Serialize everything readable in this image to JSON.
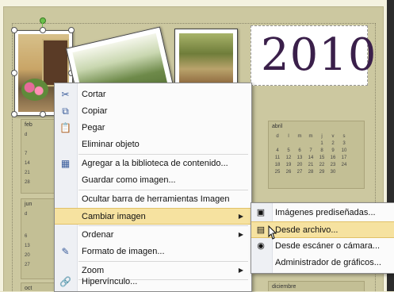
{
  "calendar": {
    "year": "2010",
    "months": {
      "feb": "feb",
      "abril": "abril",
      "jun": "jun",
      "oct": "oct",
      "diciembre": "diciembre"
    },
    "abril_weekdays": [
      "d",
      "l",
      "m",
      "m",
      "j",
      "v",
      "s"
    ],
    "abril_rows": [
      [
        "",
        "",
        "",
        "",
        "1",
        "2",
        "3"
      ],
      [
        "4",
        "5",
        "6",
        "7",
        "8",
        "9",
        "10"
      ],
      [
        "11",
        "12",
        "13",
        "14",
        "15",
        "16",
        "17"
      ],
      [
        "18",
        "19",
        "20",
        "21",
        "22",
        "23",
        "24"
      ],
      [
        "25",
        "26",
        "27",
        "28",
        "29",
        "30",
        ""
      ]
    ],
    "left_partial_days": {
      "feb": [
        "d",
        "7",
        "14",
        "21",
        "28"
      ],
      "jun": [
        "d",
        "6",
        "13",
        "20",
        "27"
      ]
    }
  },
  "context_menu": {
    "items": [
      {
        "label": "Cortar",
        "icon": "scissors-icon"
      },
      {
        "label": "Copiar",
        "icon": "copy-icon"
      },
      {
        "label": "Pegar",
        "icon": "paste-icon"
      },
      {
        "label": "Eliminar objeto",
        "icon": ""
      },
      {
        "label": "Agregar a la biblioteca de contenido...",
        "icon": "library-icon"
      },
      {
        "label": "Guardar como imagen...",
        "icon": ""
      },
      {
        "label": "Ocultar barra de herramientas Imagen",
        "icon": ""
      },
      {
        "label": "Cambiar imagen",
        "icon": "",
        "submenu": true
      },
      {
        "label": "Ordenar",
        "icon": "",
        "submenu": true
      },
      {
        "label": "Formato de imagen...",
        "icon": "format-picture-icon"
      },
      {
        "label": "Zoom",
        "icon": "",
        "submenu": true
      },
      {
        "label": "Hipervínculo...",
        "icon": "hyperlink-icon"
      }
    ]
  },
  "submenu": {
    "items": [
      {
        "label": "Imágenes prediseñadas...",
        "icon": "clipart-icon"
      },
      {
        "label": "Desde archivo...",
        "icon": "from-file-icon"
      },
      {
        "label": "Desde escáner o cámara...",
        "icon": "scanner-icon"
      },
      {
        "label": "Administrador de gráficos...",
        "icon": ""
      }
    ]
  },
  "colors": {
    "highlight": "#f6e2a0",
    "year_text": "#3a1f4a",
    "calendar_bg": "#ccc8a0"
  }
}
